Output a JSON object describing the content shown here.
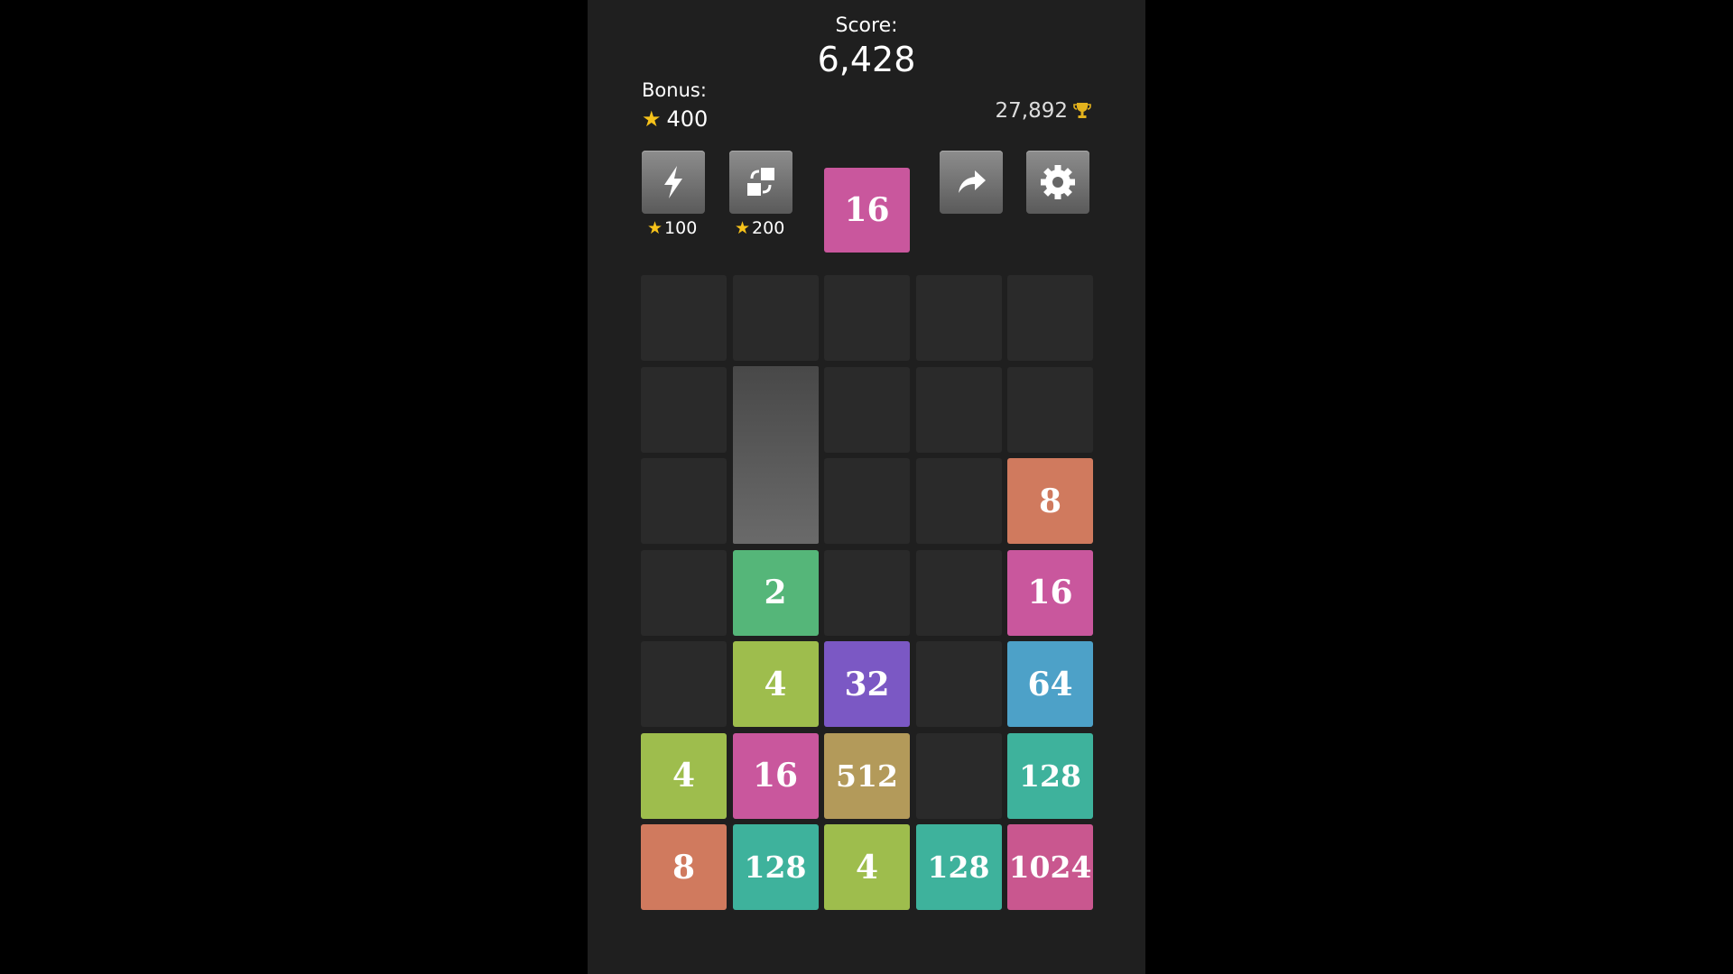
{
  "header": {
    "score_label": "Score:",
    "score_value": "6,428",
    "bonus_label": "Bonus:",
    "bonus_value": "400",
    "best_score": "27,892"
  },
  "controls": {
    "lightning": {
      "icon": "lightning-icon",
      "cost": "100"
    },
    "swap": {
      "icon": "swap-icon",
      "cost": "200"
    },
    "next_tile": {
      "value": "16",
      "color": "#c9579d"
    },
    "share": {
      "icon": "share-arrow-icon"
    },
    "settings": {
      "icon": "gear-icon"
    }
  },
  "board": {
    "columns": 5,
    "rows": 7,
    "highlighted_column": 1,
    "tiles": [
      {
        "row": 2,
        "col": 4,
        "value": "8",
        "color": "#d07a5e"
      },
      {
        "row": 3,
        "col": 1,
        "value": "2",
        "color": "#55b679"
      },
      {
        "row": 3,
        "col": 4,
        "value": "16",
        "color": "#c9579d"
      },
      {
        "row": 4,
        "col": 1,
        "value": "4",
        "color": "#9ebd4d"
      },
      {
        "row": 4,
        "col": 2,
        "value": "32",
        "color": "#7b58c4"
      },
      {
        "row": 4,
        "col": 4,
        "value": "64",
        "color": "#4da1c8"
      },
      {
        "row": 5,
        "col": 0,
        "value": "4",
        "color": "#9ebd4d"
      },
      {
        "row": 5,
        "col": 1,
        "value": "16",
        "color": "#c9579d"
      },
      {
        "row": 5,
        "col": 2,
        "value": "512",
        "color": "#b39a5a"
      },
      {
        "row": 5,
        "col": 4,
        "value": "128",
        "color": "#3eb29c"
      },
      {
        "row": 6,
        "col": 0,
        "value": "8",
        "color": "#d07a5e"
      },
      {
        "row": 6,
        "col": 1,
        "value": "128",
        "color": "#3eb29c"
      },
      {
        "row": 6,
        "col": 2,
        "value": "4",
        "color": "#9ebd4d"
      },
      {
        "row": 6,
        "col": 3,
        "value": "128",
        "color": "#3eb29c"
      },
      {
        "row": 6,
        "col": 4,
        "value": "1024",
        "color": "#c9578f"
      }
    ]
  }
}
